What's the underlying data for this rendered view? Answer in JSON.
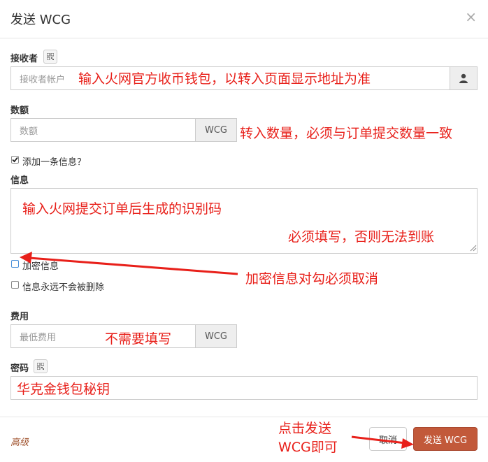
{
  "dialog": {
    "title": "发送 WCG",
    "close": "×"
  },
  "recipient": {
    "label": "接收者",
    "placeholder": "接收者帐户"
  },
  "amount": {
    "label": "数额",
    "placeholder": "数额",
    "unit": "WCG"
  },
  "add_message": {
    "label": "添加一条信息？",
    "checked": true
  },
  "message": {
    "label": "信息",
    "encrypt_label": "加密信息",
    "encrypt_checked": false,
    "never_delete_label": "信息永远不会被删除",
    "never_delete_checked": false
  },
  "fee": {
    "label": "费用",
    "placeholder": "最低费用",
    "unit": "WCG"
  },
  "password": {
    "label": "密码"
  },
  "footer": {
    "advanced": "高级",
    "cancel": "取消",
    "send": "发送 WCG"
  },
  "annotations": {
    "recipient": "输入火网官方收币钱包，以转入页面显示地址为准",
    "amount": "转入数量，必须与订单提交数量一致",
    "message_line1": "输入火网提交订单后生成的识别码",
    "message_line2": "必须填写，否则无法到账",
    "encrypt": "加密信息对勾必须取消",
    "fee": "不需要填写",
    "password": "华克金钱包秘钥",
    "send_line1": "点击发送",
    "send_line2": "WCG即可",
    "color": "#e8201a"
  }
}
